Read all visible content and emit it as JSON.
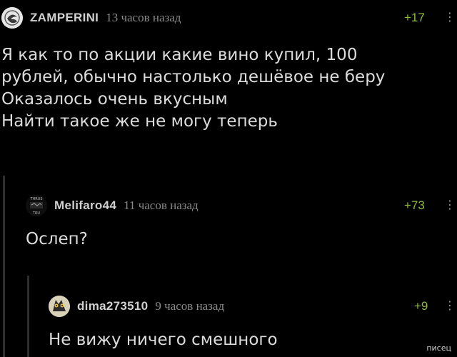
{
  "comments": [
    {
      "username": "ZAMPERINI",
      "time": "13 часов назад",
      "rating": "+17",
      "lines": [
        "Я как то по акции какие вино купил, 100",
        "рублей, обычно настолько дешёвое не беру",
        "Оказалось очень вкусным",
        "Найти такое же не могу теперь"
      ]
    },
    {
      "username": "Melifaro44",
      "time": "11 часов назад",
      "rating": "+73",
      "lines": [
        "Ослеп?"
      ],
      "avatar_text_top": "THRUS",
      "avatar_text_bottom": "TRU"
    },
    {
      "username": "dima273510",
      "time": "9 часов назад",
      "rating": "+9",
      "lines": [
        "Не вижу ничего смешного"
      ]
    }
  ],
  "watermark": "писец",
  "colors": {
    "background": "#000000",
    "rating": "#8fbc3c",
    "text": "#dcdcdc",
    "muted": "#8a8a8a",
    "thread_line": "#2e2e2e"
  },
  "icons": [
    "ellipsis-vertical-icon"
  ]
}
